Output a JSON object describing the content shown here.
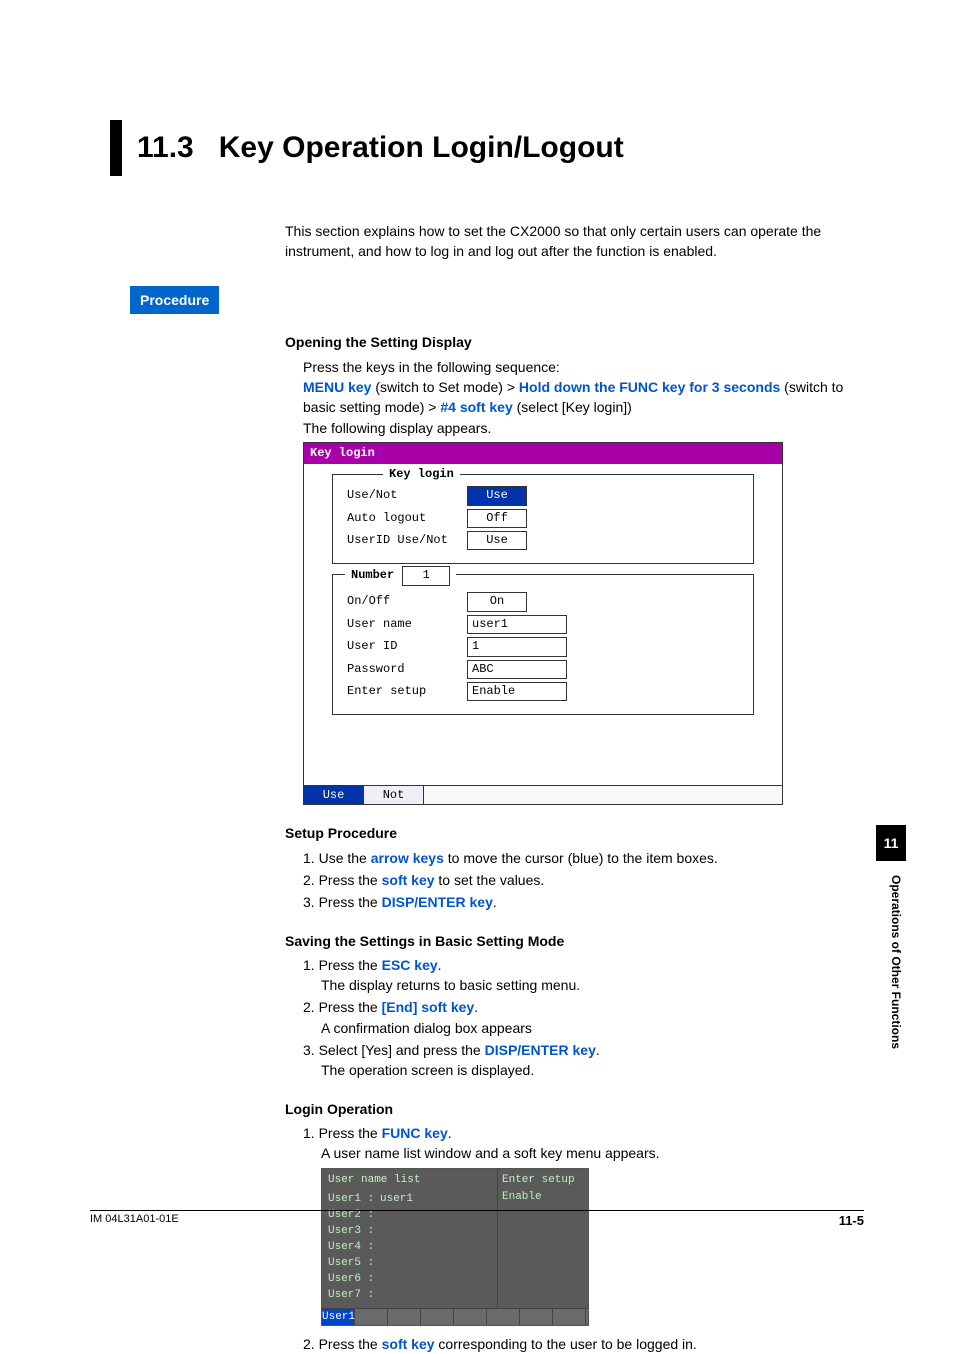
{
  "section_number": "11.3",
  "section_title": "Key Operation Login/Logout",
  "intro": "This section explains how to set the CX2000 so that only certain users can operate the instrument, and how to log in and log out after the function is enabled.",
  "procedure_label": "Procedure",
  "opening": {
    "heading": "Opening the Setting Display",
    "line1": "Press the keys in the following sequence:",
    "menu_key": "MENU key",
    "menu_key_after": " (switch to Set mode) > ",
    "func_key": "Hold down the FUNC key for 3 seconds",
    "func_key_after": " (switch to basic setting mode) > ",
    "soft4": "#4 soft key",
    "soft4_after": " (select [Key login])",
    "line3": "The following display appears."
  },
  "screen1": {
    "titlebar": "Key login",
    "group1_legend": "Key login",
    "rows1": [
      {
        "label": "Use/Not",
        "value": "Use",
        "selected": true
      },
      {
        "label": "Auto logout",
        "value": "Off",
        "selected": false
      },
      {
        "label": "UserID Use/Not",
        "value": "Use",
        "selected": false
      }
    ],
    "number_label": "Number",
    "number_value": "1",
    "rows2": [
      {
        "label": "On/Off",
        "value": "On",
        "wide": false
      },
      {
        "label": "User name",
        "value": "user1",
        "wide": true
      },
      {
        "label": "User ID",
        "value": "1",
        "wide": true
      },
      {
        "label": "Password",
        "value": "ABC",
        "wide": true
      },
      {
        "label": "Enter setup",
        "value": "Enable",
        "wide": true
      }
    ],
    "softkeys": {
      "sel": "Use",
      "plain": "Not"
    }
  },
  "setup_proc": {
    "heading": "Setup Procedure",
    "step1_pre": "Use the ",
    "step1_key": "arrow keys",
    "step1_post": " to move the cursor (blue) to the item boxes.",
    "step2_pre": "Press the ",
    "step2_key": "soft key",
    "step2_post": " to set the values.",
    "step3_pre": "Press the ",
    "step3_key": "DISP/ENTER key",
    "step3_post": "."
  },
  "saving": {
    "heading": "Saving the Settings in Basic Setting Mode",
    "s1_pre": "Press the ",
    "s1_key": "ESC key",
    "s1_post": ".",
    "s1_sub": "The display returns to basic setting menu.",
    "s2_pre": "Press the ",
    "s2_key": "[End] soft key",
    "s2_post": ".",
    "s2_sub": "A confirmation dialog box appears",
    "s3_pre": "Select [Yes] and press the ",
    "s3_key": "DISP/ENTER key",
    "s3_post": ".",
    "s3_sub": "The operation screen is displayed."
  },
  "login": {
    "heading": "Login Operation",
    "s1_pre": "Press the ",
    "s1_key": "FUNC key",
    "s1_post": ".",
    "s1_sub": "A user name list window and a soft key menu appears.",
    "s2_pre": "Press the ",
    "s2_key": "soft key",
    "s2_post": " corresponding to the user to be logged in."
  },
  "screen2": {
    "header": "User name list",
    "right_label": "Enter setup",
    "right_value": "Enable",
    "users": [
      {
        "slot": "User1 :",
        "name": "user1"
      },
      {
        "slot": "User2 :",
        "name": ""
      },
      {
        "slot": "User3 :",
        "name": ""
      },
      {
        "slot": "User4 :",
        "name": ""
      },
      {
        "slot": "User5 :",
        "name": ""
      },
      {
        "slot": "User6 :",
        "name": ""
      },
      {
        "slot": "User7 :",
        "name": ""
      }
    ],
    "soft_selected": "User1"
  },
  "sidetab_number": "11",
  "sidetab_text": "Operations of Other Functions",
  "footer_left": "IM 04L31A01-01E",
  "footer_right": "11-5"
}
